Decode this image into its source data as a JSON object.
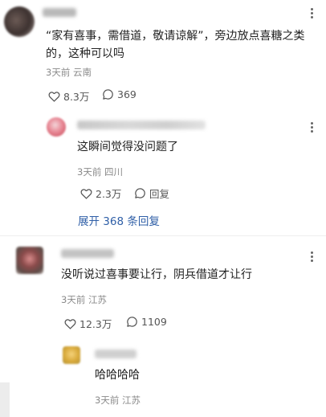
{
  "comments": [
    {
      "text": "“家有喜事，需借道，敬请谅解”，旁边放点喜糖之类的，这种可以吗",
      "time": "3天前",
      "location": "云南",
      "likes": "8.3万",
      "replies": "369",
      "reply": {
        "text": "这瞬间觉得没问题了",
        "time": "3天前",
        "location": "四川",
        "likes": "2.3万",
        "reply_label": "回复",
        "expand": "展开 368 条回复"
      }
    },
    {
      "text": "没听说过喜事要让行，阴兵借道才让行",
      "time": "3天前",
      "location": "江苏",
      "likes": "12.3万",
      "replies": "1109",
      "reply": {
        "text": "哈哈哈哈",
        "time": "3天前",
        "location": "江苏"
      }
    }
  ],
  "icons": {
    "like": "heart-outline-icon",
    "comment": "comment-bubble-icon",
    "more": "more-vertical-icon"
  },
  "colors": {
    "link": "#2f5fa7",
    "meta": "#8a8a8a"
  }
}
